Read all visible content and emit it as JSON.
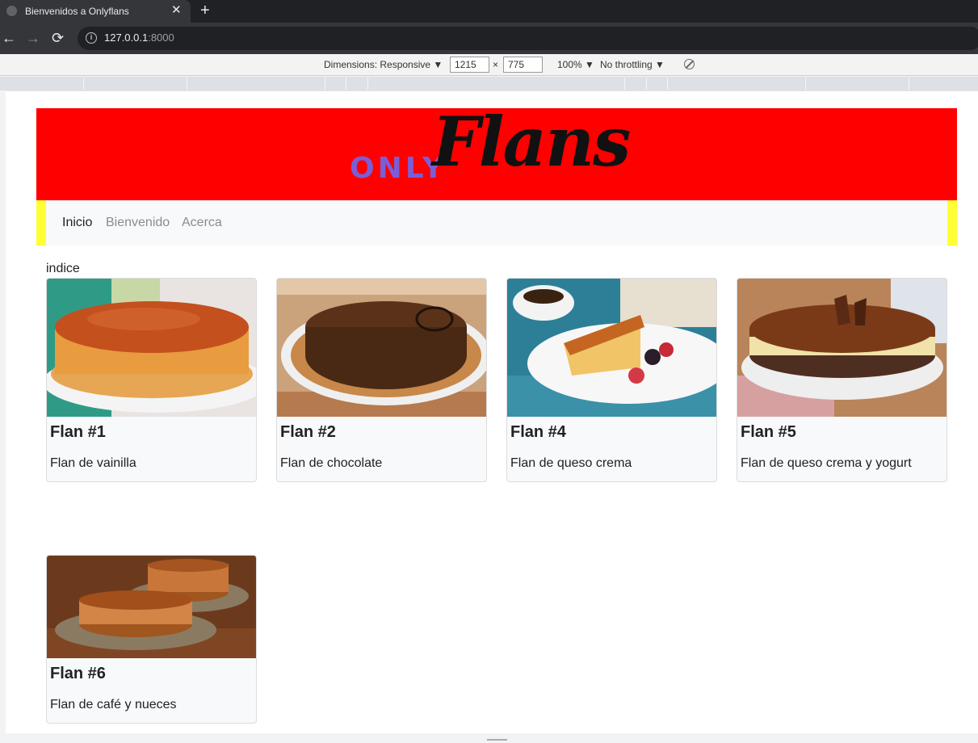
{
  "browser": {
    "tab_title": "Bienvenidos a Onlyflans",
    "tab_close": "✕",
    "new_tab": "+",
    "url_host": "127.0.0.1",
    "url_port": ":8000",
    "back": "←",
    "forward": "→",
    "reload": "⟳"
  },
  "devtools": {
    "dimensions_label": "Dimensions: Responsive ▼",
    "width": "1215",
    "times": "×",
    "height": "775",
    "zoom": "100% ▼",
    "throttling": "No throttling ▼"
  },
  "site": {
    "logo_only": "ONLY",
    "logo_flans": "Flans",
    "banner_color": "#ff0000",
    "nav": [
      {
        "label": "Inicio"
      },
      {
        "label": "Bienvenido"
      },
      {
        "label": "Acerca"
      }
    ],
    "heading": "indice",
    "cards": [
      {
        "title": "Flan #1",
        "text": "Flan de vainilla"
      },
      {
        "title": "Flan #2",
        "text": "Flan de chocolate"
      },
      {
        "title": "Flan #4",
        "text": "Flan de queso crema"
      },
      {
        "title": "Flan #5",
        "text": "Flan de queso crema y yogurt"
      },
      {
        "title": "Flan #6",
        "text": "Flan de café y nueces"
      }
    ]
  }
}
